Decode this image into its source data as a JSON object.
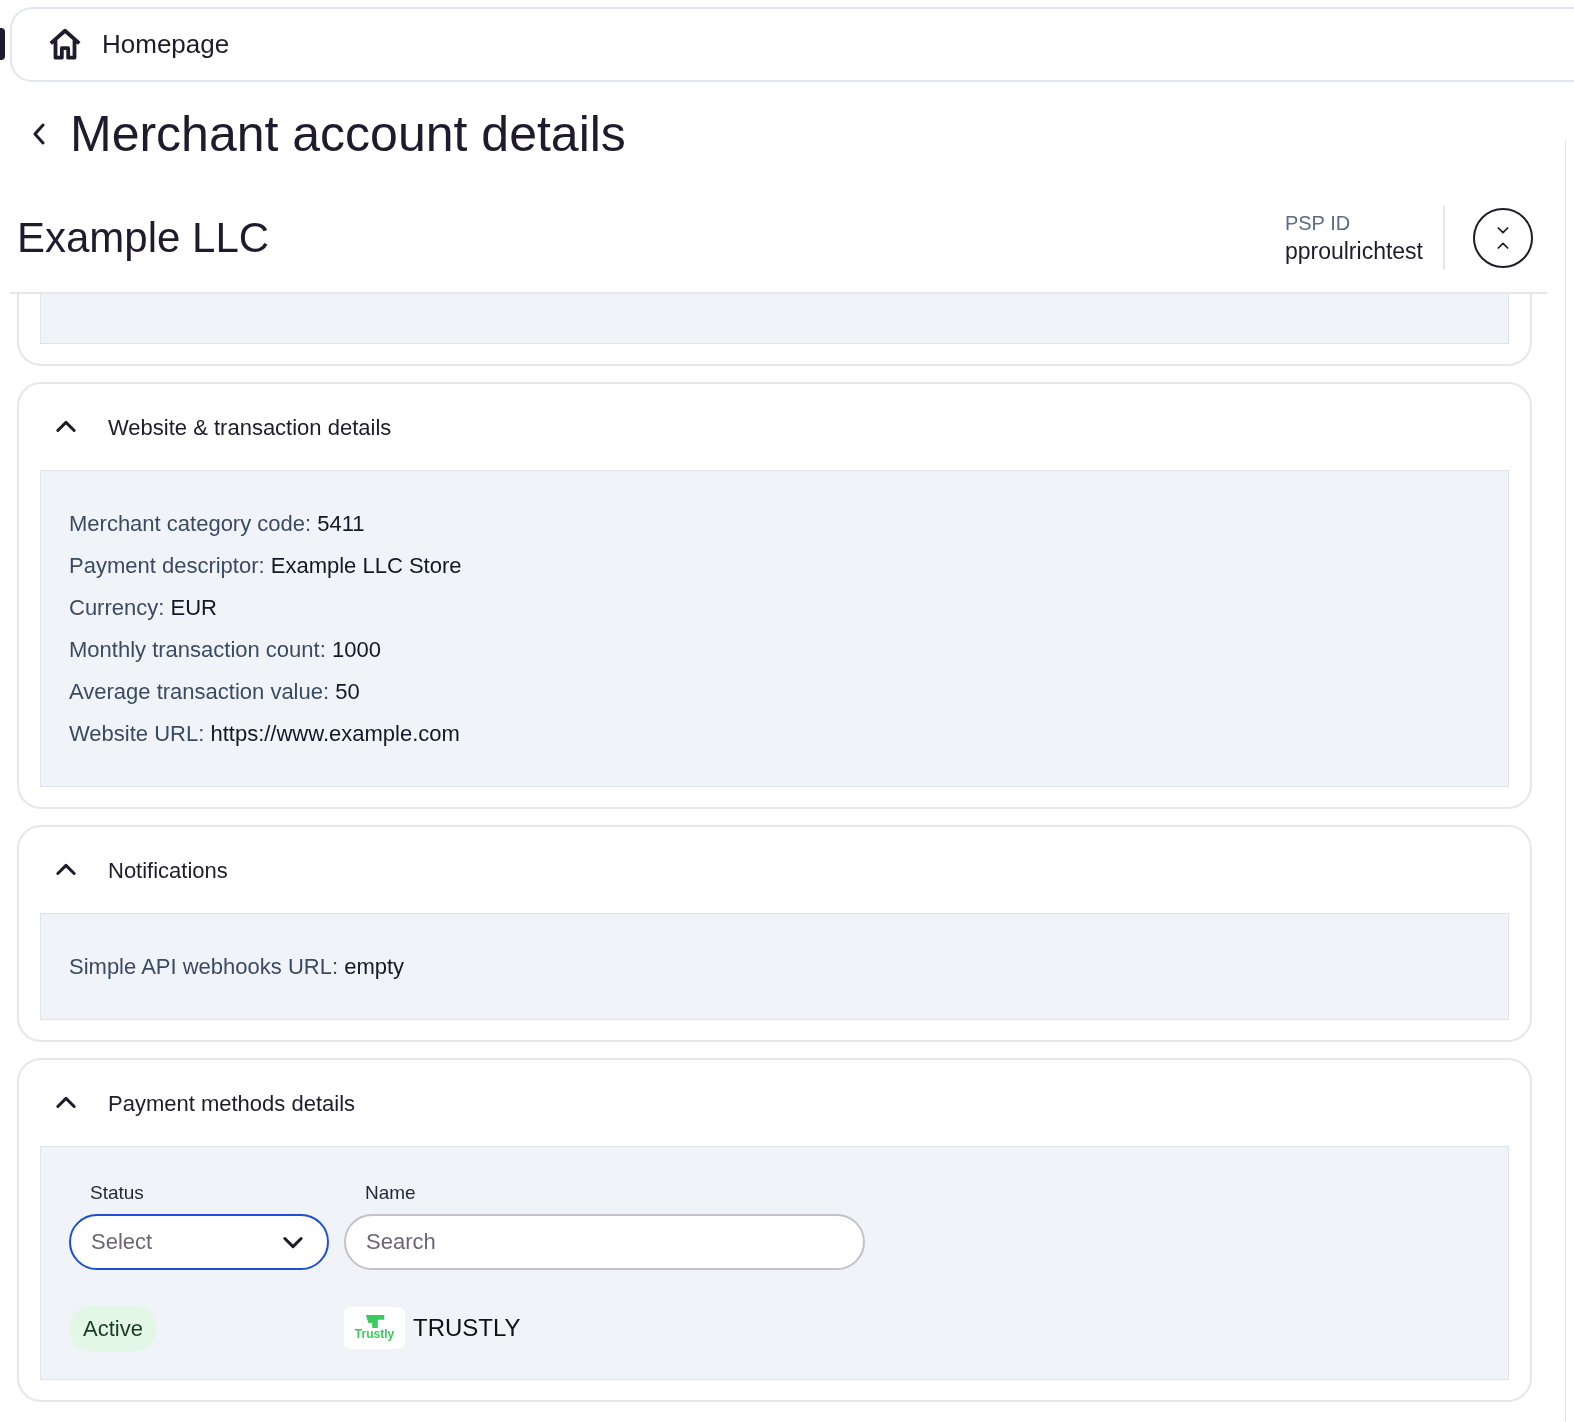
{
  "breadcrumb": {
    "label": "Homepage"
  },
  "page_title": "Merchant account details",
  "merchant": {
    "name": "Example LLC",
    "psp_id_label": "PSP ID",
    "psp_id": "pproulrichtest"
  },
  "sections": [
    {
      "kind": "fields",
      "title": "Website & transaction details",
      "expanded": true,
      "fields": [
        {
          "label": "Merchant category code:",
          "value": "5411"
        },
        {
          "label": "Payment descriptor:",
          "value": "Example LLC Store"
        },
        {
          "label": "Currency:",
          "value": "EUR"
        },
        {
          "label": "Monthly transaction count:",
          "value": "1000"
        },
        {
          "label": "Average transaction value:",
          "value": "50"
        },
        {
          "label": "Website URL:",
          "value": "https://www.example.com"
        }
      ]
    },
    {
      "kind": "fields",
      "title": "Notifications",
      "expanded": true,
      "fields": [
        {
          "label": "Simple API webhooks URL:",
          "value": "empty"
        }
      ]
    },
    {
      "kind": "payment_methods",
      "title": "Payment methods details",
      "expanded": true,
      "status_filter": {
        "label": "Status",
        "placeholder": "Select",
        "focused": true
      },
      "name_filter": {
        "label": "Name",
        "placeholder": "Search"
      },
      "methods": [
        {
          "status": "Active",
          "logo_text": "Trustly",
          "name": "TRUSTLY"
        }
      ]
    }
  ]
}
